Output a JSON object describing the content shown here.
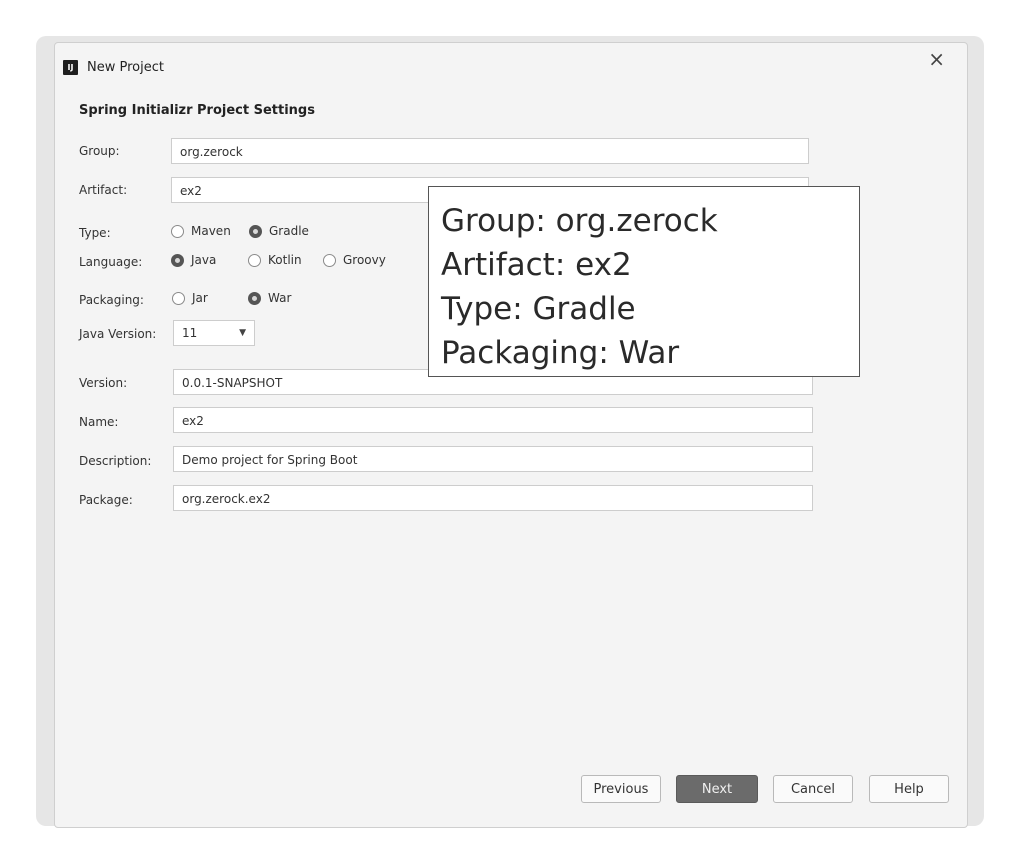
{
  "window": {
    "title": "New Project",
    "close_glyph": "×",
    "app_icon": "IJ"
  },
  "section_title": "Spring Initializr Project Settings",
  "fields": {
    "group": {
      "label": "Group:",
      "value": "org.zerock"
    },
    "artifact": {
      "label": "Artifact:",
      "value": "ex2"
    },
    "version": {
      "label": "Version:",
      "value": "0.0.1-SNAPSHOT"
    },
    "name": {
      "label": "Name:",
      "value": "ex2"
    },
    "description": {
      "label": "Description:",
      "value": "Demo project for Spring Boot"
    },
    "package": {
      "label": "Package:",
      "value": "org.zerock.ex2"
    }
  },
  "type": {
    "label": "Type:",
    "options": [
      "Maven",
      "Gradle"
    ],
    "selected": "Gradle"
  },
  "language": {
    "label": "Language:",
    "options": [
      "Java",
      "Kotlin",
      "Groovy"
    ],
    "selected": "Java"
  },
  "packaging": {
    "label": "Packaging:",
    "options": [
      "Jar",
      "War"
    ],
    "selected": "War"
  },
  "java_version": {
    "label": "Java Version:",
    "value": "11"
  },
  "buttons": {
    "previous": "Previous",
    "next": "Next",
    "cancel": "Cancel",
    "help": "Help"
  },
  "callout": {
    "lines": [
      "Group: org.zerock",
      "Artifact: ex2",
      "Type: Gradle",
      "Packaging: War"
    ]
  }
}
